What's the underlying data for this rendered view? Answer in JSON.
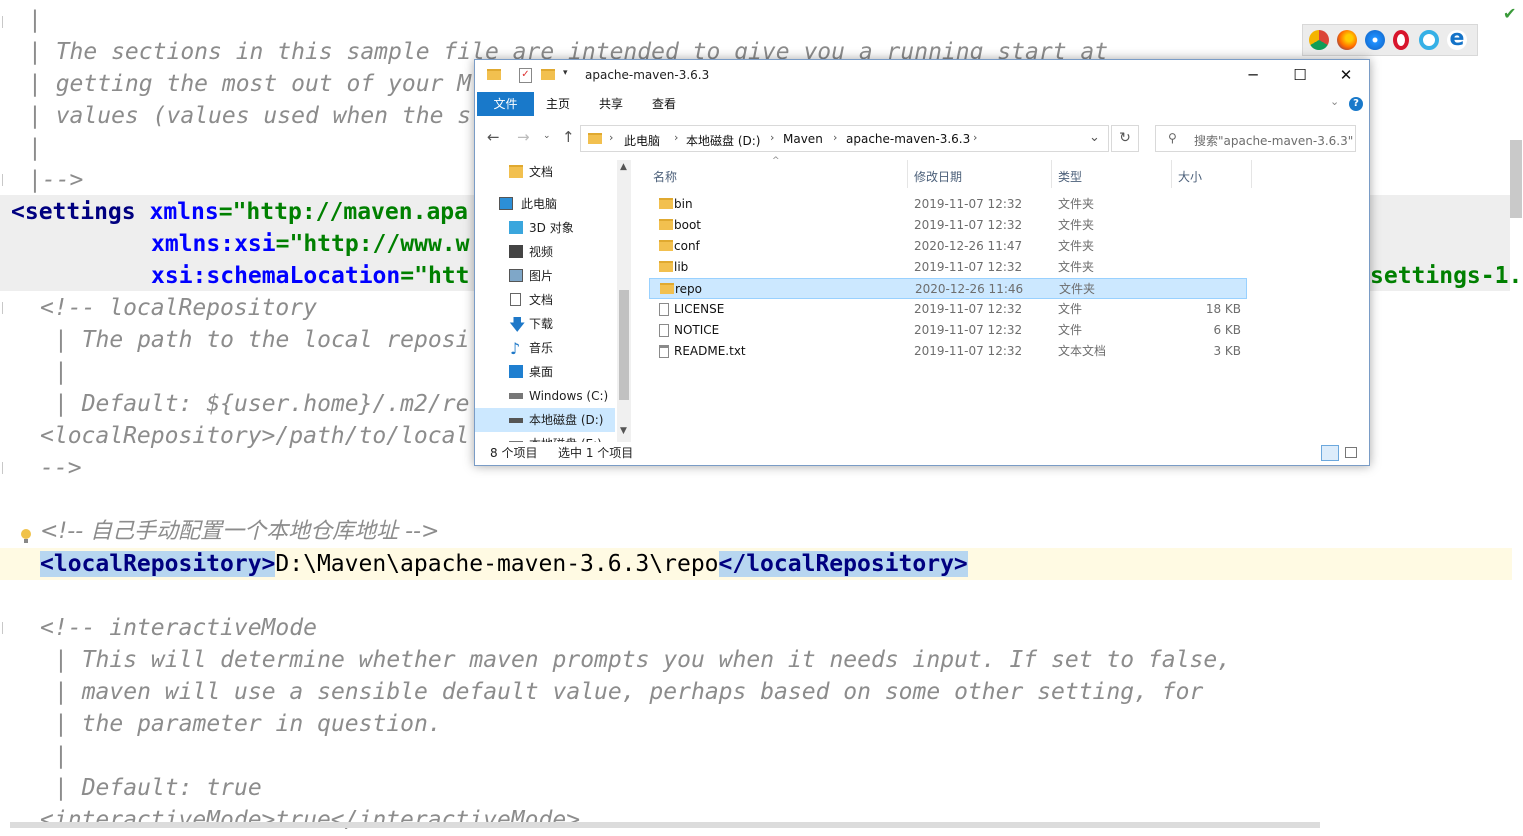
{
  "editor": {
    "comment_lines": [
      "|",
      "| The sections in this sample file are intended to give you a running start at",
      "| getting the most out of your M",
      "| values (values used when the s",
      "|",
      "|-->"
    ],
    "settings_open": {
      "tag": "<settings",
      "attr1": "xmlns",
      "val1": "=\"http://maven.apa",
      "attr2": "xmlns:xsi",
      "val2": "=\"http://www.w",
      "attr3": "xsi:schemaLocation",
      "val3": "=\"htt",
      "val3_tail": "settings-1."
    },
    "local_repo_comment": [
      "<!-- localRepository",
      "| The path to the local reposi",
      "|",
      "| Default: ${user.home}/.m2/re",
      "<localRepository>/path/to/local",
      "-->"
    ],
    "custom_comment": "<!-- 自己手动配置一个本地仓库地址 -->",
    "repo_open_tag": "<localRepository>",
    "repo_value": "D:\\Maven\\apache-maven-3.6.3\\repo",
    "repo_close_tag": "</localRepository>",
    "interactive_comment": [
      "<!-- interactiveMode",
      "| This will determine whether maven prompts you when it needs input. If set to false,",
      "| maven will use a sensible default value, perhaps based on some other setting, for",
      "| the parameter in question.",
      "|",
      "| Default: true",
      "<interactiveMode>true</interactiveMode>"
    ]
  },
  "browser_icons": [
    "chrome-icon",
    "firefox-icon",
    "safari-icon",
    "opera-icon",
    "ie-icon",
    "edge-icon"
  ],
  "explorer": {
    "title": "apache-maven-3.6.3",
    "ribbon_tabs": [
      "文件",
      "主页",
      "共享",
      "查看"
    ],
    "breadcrumbs": [
      "此电脑",
      "本地磁盘 (D:)",
      "Maven",
      "apache-maven-3.6.3"
    ],
    "search_placeholder": "搜索\"apache-maven-3.6.3\"",
    "nav_items": [
      {
        "label": "文档",
        "icon": "folder-icon"
      },
      {
        "label": "此电脑",
        "icon": "computer-icon"
      },
      {
        "label": "3D 对象",
        "icon": "3d-objects-icon"
      },
      {
        "label": "视频",
        "icon": "video-icon"
      },
      {
        "label": "图片",
        "icon": "pictures-icon"
      },
      {
        "label": "文档",
        "icon": "documents-icon"
      },
      {
        "label": "下载",
        "icon": "download-icon"
      },
      {
        "label": "音乐",
        "icon": "music-icon"
      },
      {
        "label": "桌面",
        "icon": "desktop-icon"
      },
      {
        "label": "Windows (C:)",
        "icon": "drive-c-icon"
      },
      {
        "label": "本地磁盘 (D:)",
        "icon": "drive-d-icon"
      },
      {
        "label": "本地磁盘 (E:)",
        "icon": "drive-e-icon"
      }
    ],
    "columns": [
      "名称",
      "修改日期",
      "类型",
      "大小"
    ],
    "files": [
      {
        "name": "bin",
        "date": "2019-11-07 12:32",
        "type": "文件夹",
        "size": "",
        "kind": "folder"
      },
      {
        "name": "boot",
        "date": "2019-11-07 12:32",
        "type": "文件夹",
        "size": "",
        "kind": "folder"
      },
      {
        "name": "conf",
        "date": "2020-12-26 11:47",
        "type": "文件夹",
        "size": "",
        "kind": "folder"
      },
      {
        "name": "lib",
        "date": "2019-11-07 12:32",
        "type": "文件夹",
        "size": "",
        "kind": "folder"
      },
      {
        "name": "repo",
        "date": "2020-12-26 11:46",
        "type": "文件夹",
        "size": "",
        "kind": "folder"
      },
      {
        "name": "LICENSE",
        "date": "2019-11-07 12:32",
        "type": "文件",
        "size": "18 KB",
        "kind": "file"
      },
      {
        "name": "NOTICE",
        "date": "2019-11-07 12:32",
        "type": "文件",
        "size": "6 KB",
        "kind": "file"
      },
      {
        "name": "README.txt",
        "date": "2019-11-07 12:32",
        "type": "文本文档",
        "size": "3 KB",
        "kind": "text"
      }
    ],
    "status_count": "8 个项目",
    "status_selected": "选中 1 个项目"
  }
}
